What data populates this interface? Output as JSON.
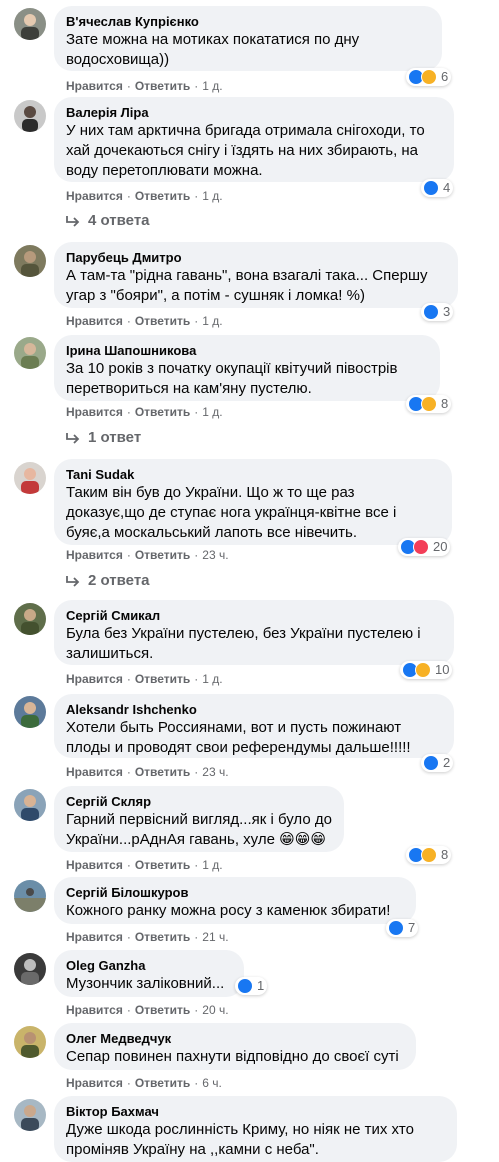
{
  "labels": {
    "like": "Нравится",
    "reply": "Ответить",
    "dot": "·"
  },
  "colors": {
    "like_blue": "#1877f2",
    "haha_yellow": "#f7b125",
    "love_red": "#f33e58"
  },
  "comments": [
    {
      "author": "В'ячеслав Купрієнко",
      "text": "Зате можна на мотиках покататися по дну\nводосховища))",
      "time": "1 д.",
      "reactions": [
        "like",
        "haha"
      ],
      "reaction_count": "6"
    },
    {
      "author": "Валерія Ліра",
      "text": "У них там арктична бригада отримала снігоходи, то\nхай дочекаються снігу і їздять на них збирають, на\nводу перетоплювати можна.",
      "time": "1 д.",
      "reactions": [
        "like"
      ],
      "reaction_count": "4",
      "replies": "4 ответа"
    },
    {
      "author": "Парубець Дмитро",
      "text": "А там-та \"рідна гавань\", вона взагалі така... Спершу\nугар з \"бояри\", а потім - сушняк і ломка! %)",
      "time": "1 д.",
      "reactions": [
        "like"
      ],
      "reaction_count": "3"
    },
    {
      "author": "Ірина Шапошникова",
      "text": "За 10 років з початку окупації квітучий півострів\nперетвориться на кам'яну пустелю.",
      "time": "1 д.",
      "reactions": [
        "like",
        "haha"
      ],
      "reaction_count": "8",
      "replies": "1 ответ"
    },
    {
      "author": "Tani Sudak",
      "text": "Таким він був до України. Що ж то ще раз\nдоказує,що де ступає нога українця-квітне все і\nбуяє,а москальський лапоть все нівечить.",
      "time": "23 ч.",
      "reactions": [
        "like",
        "love"
      ],
      "reaction_count": "20",
      "replies": "2 ответа"
    },
    {
      "author": "Сергій Смикал",
      "text": "Була без України пустелею, без України пустелею і\nзалишиться.",
      "time": "1 д.",
      "reactions": [
        "like",
        "haha"
      ],
      "reaction_count": "10"
    },
    {
      "author": "Aleksandr Ishchenko",
      "text": "Хотели быть Россиянами, вот и пусть пожинают\nплоды и проводят свои референдумы дальше!!!!!",
      "time": "23 ч.",
      "reactions": [
        "like"
      ],
      "reaction_count": "2"
    },
    {
      "author": "Сергій Скляр",
      "text": "Гарний первісний вигляд...як і було до\nУкраїни...рАднАя гавань, хуле 😁😁😁",
      "time": "1 д.",
      "reactions": [
        "like",
        "haha"
      ],
      "reaction_count": "8"
    },
    {
      "author": "Сергій Білошкуров",
      "text": "Кожного ранку можна росу з каменюк збирати!",
      "time": "21 ч.",
      "reactions": [
        "like"
      ],
      "reaction_count": "7"
    },
    {
      "author": "Oleg Ganzha",
      "text": "Музончик заліковний...",
      "time": "20 ч.",
      "reactions": [
        "like"
      ],
      "reaction_count": "1"
    },
    {
      "author": "Олег Медведчук",
      "text": "Сепар повинен пахнути відповідно до своєї суті",
      "time": "6 ч."
    },
    {
      "author": "Віктор Бахмач",
      "text": "Дуже шкода рослинність Криму, но ніяк не тих хто\nпроміняв Україну на ,,камни с неба\"."
    }
  ]
}
